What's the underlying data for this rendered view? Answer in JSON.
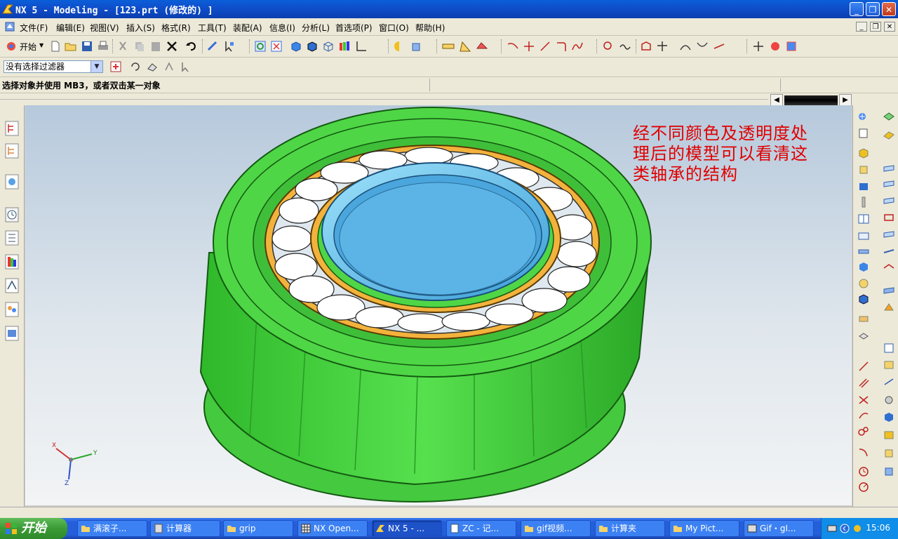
{
  "window": {
    "title": "NX 5 - Modeling - [123.prt  (修改的) ]",
    "minimize": "_",
    "maximize": "❐",
    "close": "✕"
  },
  "menu": {
    "items": [
      "文件(F)",
      "编辑(E)",
      "视图(V)",
      "插入(S)",
      "格式(R)",
      "工具(T)",
      "装配(A)",
      "信息(I)",
      "分析(L)",
      "首选项(P)",
      "窗口(O)",
      "帮助(H)"
    ]
  },
  "toolbar": {
    "start_label": "开始"
  },
  "filter": {
    "selected": "没有选择过滤器"
  },
  "status": {
    "message": "选择对象并使用 MB3，或者双击某一对象"
  },
  "annotation": {
    "line1": "经不同颜色及透明度处",
    "line2": "理后的模型可以看清这",
    "line3": "类轴承的结构"
  },
  "triad": {
    "x": "X",
    "y": "Y",
    "z": "Z"
  },
  "taskbar": {
    "start": "开始",
    "tasks": [
      "满滚子...",
      "计算器",
      "grip",
      "NX Open...",
      "NX 5 - ...",
      "ZC - 记...",
      "gif视频...",
      "计算夹",
      "My Pict...",
      "Gif・gI..."
    ],
    "clock": "15:06"
  },
  "colors": {
    "outer_ring": "#3fd23a",
    "cage": "#f3b23c",
    "inner_ring": "#6ec8f0",
    "annotation": "#e00000"
  }
}
